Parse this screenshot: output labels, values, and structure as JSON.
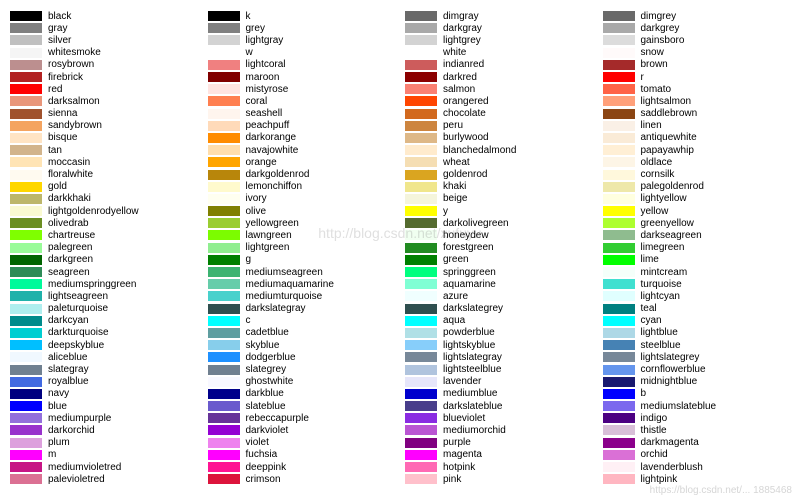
{
  "watermark": "http://blog.csdn.net/xufuyu",
  "corner": "https://blog.csdn.net/... 1885468",
  "chart_data": {
    "type": "table",
    "title": "",
    "columns": [
      [
        {
          "c": "#000000",
          "n": "black"
        },
        {
          "c": "#808080",
          "n": "gray"
        },
        {
          "c": "#C0C0C0",
          "n": "silver"
        },
        {
          "c": "#F5F5F5",
          "n": "whitesmoke"
        },
        {
          "c": "#BC8F8F",
          "n": "rosybrown"
        },
        {
          "c": "#B22222",
          "n": "firebrick"
        },
        {
          "c": "#FF0000",
          "n": "red"
        },
        {
          "c": "#E9967A",
          "n": "darksalmon"
        },
        {
          "c": "#A0522D",
          "n": "sienna"
        },
        {
          "c": "#F4A460",
          "n": "sandybrown"
        },
        {
          "c": "#FFE4C4",
          "n": "bisque"
        },
        {
          "c": "#D2B48C",
          "n": "tan"
        },
        {
          "c": "#FFE4B5",
          "n": "moccasin"
        },
        {
          "c": "#FFFAF0",
          "n": "floralwhite"
        },
        {
          "c": "#FFD700",
          "n": "gold"
        },
        {
          "c": "#BDB76B",
          "n": "darkkhaki"
        },
        {
          "c": "#FAFAD2",
          "n": "lightgoldenrodyellow"
        },
        {
          "c": "#6B8E23",
          "n": "olivedrab"
        },
        {
          "c": "#7FFF00",
          "n": "chartreuse"
        },
        {
          "c": "#98FB98",
          "n": "palegreen"
        },
        {
          "c": "#006400",
          "n": "darkgreen"
        },
        {
          "c": "#2E8B57",
          "n": "seagreen"
        },
        {
          "c": "#00FA9A",
          "n": "mediumspringgreen"
        },
        {
          "c": "#20B2AA",
          "n": "lightseagreen"
        },
        {
          "c": "#AFEEEE",
          "n": "paleturquoise"
        },
        {
          "c": "#008B8B",
          "n": "darkcyan"
        },
        {
          "c": "#00CED1",
          "n": "darkturquoise"
        },
        {
          "c": "#00BFFF",
          "n": "deepskyblue"
        },
        {
          "c": "#F0F8FF",
          "n": "aliceblue"
        },
        {
          "c": "#708090",
          "n": "slategray"
        },
        {
          "c": "#4169E1",
          "n": "royalblue"
        },
        {
          "c": "#000080",
          "n": "navy"
        },
        {
          "c": "#0000FF",
          "n": "blue"
        },
        {
          "c": "#9370DB",
          "n": "mediumpurple"
        },
        {
          "c": "#9932CC",
          "n": "darkorchid"
        },
        {
          "c": "#DDA0DD",
          "n": "plum"
        },
        {
          "c": "#FF00FF",
          "n": "m"
        },
        {
          "c": "#C71585",
          "n": "mediumvioletred"
        },
        {
          "c": "#DB7093",
          "n": "palevioletred"
        }
      ],
      [
        {
          "c": "#000000",
          "n": "k"
        },
        {
          "c": "#808080",
          "n": "grey"
        },
        {
          "c": "#D3D3D3",
          "n": "lightgray"
        },
        {
          "c": "#FFFFFF",
          "n": "w"
        },
        {
          "c": "#F08080",
          "n": "lightcoral"
        },
        {
          "c": "#800000",
          "n": "maroon"
        },
        {
          "c": "#FFE4E1",
          "n": "mistyrose"
        },
        {
          "c": "#FF7F50",
          "n": "coral"
        },
        {
          "c": "#FFF5EE",
          "n": "seashell"
        },
        {
          "c": "#FFDAB9",
          "n": "peachpuff"
        },
        {
          "c": "#FF8C00",
          "n": "darkorange"
        },
        {
          "c": "#FFDEAD",
          "n": "navajowhite"
        },
        {
          "c": "#FFA500",
          "n": "orange"
        },
        {
          "c": "#B8860B",
          "n": "darkgoldenrod"
        },
        {
          "c": "#FFFACD",
          "n": "lemonchiffon"
        },
        {
          "c": "#FFFFF0",
          "n": "ivory"
        },
        {
          "c": "#808000",
          "n": "olive"
        },
        {
          "c": "#9ACD32",
          "n": "yellowgreen"
        },
        {
          "c": "#7CFC00",
          "n": "lawngreen"
        },
        {
          "c": "#90EE90",
          "n": "lightgreen"
        },
        {
          "c": "#008000",
          "n": "g"
        },
        {
          "c": "#3CB371",
          "n": "mediumseagreen"
        },
        {
          "c": "#66CDAA",
          "n": "mediumaquamarine"
        },
        {
          "c": "#48D1CC",
          "n": "mediumturquoise"
        },
        {
          "c": "#2F4F4F",
          "n": "darkslategray"
        },
        {
          "c": "#00FFFF",
          "n": "c"
        },
        {
          "c": "#5F9EA0",
          "n": "cadetblue"
        },
        {
          "c": "#87CEEB",
          "n": "skyblue"
        },
        {
          "c": "#1E90FF",
          "n": "dodgerblue"
        },
        {
          "c": "#708090",
          "n": "slategrey"
        },
        {
          "c": "#F8F8FF",
          "n": "ghostwhite"
        },
        {
          "c": "#00008B",
          "n": "darkblue"
        },
        {
          "c": "#6A5ACD",
          "n": "slateblue"
        },
        {
          "c": "#663399",
          "n": "rebeccapurple"
        },
        {
          "c": "#9400D3",
          "n": "darkviolet"
        },
        {
          "c": "#EE82EE",
          "n": "violet"
        },
        {
          "c": "#FF00FF",
          "n": "fuchsia"
        },
        {
          "c": "#FF1493",
          "n": "deeppink"
        },
        {
          "c": "#DC143C",
          "n": "crimson"
        }
      ],
      [
        {
          "c": "#696969",
          "n": "dimgray"
        },
        {
          "c": "#A9A9A9",
          "n": "darkgray"
        },
        {
          "c": "#D3D3D3",
          "n": "lightgrey"
        },
        {
          "c": "#FFFFFF",
          "n": "white"
        },
        {
          "c": "#CD5C5C",
          "n": "indianred"
        },
        {
          "c": "#8B0000",
          "n": "darkred"
        },
        {
          "c": "#FA8072",
          "n": "salmon"
        },
        {
          "c": "#FF4500",
          "n": "orangered"
        },
        {
          "c": "#D2691E",
          "n": "chocolate"
        },
        {
          "c": "#CD853F",
          "n": "peru"
        },
        {
          "c": "#DEB887",
          "n": "burlywood"
        },
        {
          "c": "#FFEBCD",
          "n": "blanchedalmond"
        },
        {
          "c": "#F5DEB3",
          "n": "wheat"
        },
        {
          "c": "#DAA520",
          "n": "goldenrod"
        },
        {
          "c": "#F0E68C",
          "n": "khaki"
        },
        {
          "c": "#F5F5DC",
          "n": "beige"
        },
        {
          "c": "#FFFF00",
          "n": "y"
        },
        {
          "c": "#556B2F",
          "n": "darkolivegreen"
        },
        {
          "c": "#F0FFF0",
          "n": "honeydew"
        },
        {
          "c": "#228B22",
          "n": "forestgreen"
        },
        {
          "c": "#008000",
          "n": "green"
        },
        {
          "c": "#00FF7F",
          "n": "springgreen"
        },
        {
          "c": "#7FFFD4",
          "n": "aquamarine"
        },
        {
          "c": "#F0FFFF",
          "n": "azure"
        },
        {
          "c": "#2F4F4F",
          "n": "darkslategrey"
        },
        {
          "c": "#00FFFF",
          "n": "aqua"
        },
        {
          "c": "#B0E0E6",
          "n": "powderblue"
        },
        {
          "c": "#87CEFA",
          "n": "lightskyblue"
        },
        {
          "c": "#778899",
          "n": "lightslategray"
        },
        {
          "c": "#B0C4DE",
          "n": "lightsteelblue"
        },
        {
          "c": "#E6E6FA",
          "n": "lavender"
        },
        {
          "c": "#0000CD",
          "n": "mediumblue"
        },
        {
          "c": "#483D8B",
          "n": "darkslateblue"
        },
        {
          "c": "#8A2BE2",
          "n": "blueviolet"
        },
        {
          "c": "#BA55D3",
          "n": "mediumorchid"
        },
        {
          "c": "#800080",
          "n": "purple"
        },
        {
          "c": "#FF00FF",
          "n": "magenta"
        },
        {
          "c": "#FF69B4",
          "n": "hotpink"
        },
        {
          "c": "#FFC0CB",
          "n": "pink"
        }
      ],
      [
        {
          "c": "#696969",
          "n": "dimgrey"
        },
        {
          "c": "#A9A9A9",
          "n": "darkgrey"
        },
        {
          "c": "#DCDCDC",
          "n": "gainsboro"
        },
        {
          "c": "#FFFAFA",
          "n": "snow"
        },
        {
          "c": "#A52A2A",
          "n": "brown"
        },
        {
          "c": "#FF0000",
          "n": "r"
        },
        {
          "c": "#FF6347",
          "n": "tomato"
        },
        {
          "c": "#FFA07A",
          "n": "lightsalmon"
        },
        {
          "c": "#8B4513",
          "n": "saddlebrown"
        },
        {
          "c": "#FAF0E6",
          "n": "linen"
        },
        {
          "c": "#FAEBD7",
          "n": "antiquewhite"
        },
        {
          "c": "#FFEFD5",
          "n": "papayawhip"
        },
        {
          "c": "#FDF5E6",
          "n": "oldlace"
        },
        {
          "c": "#FFF8DC",
          "n": "cornsilk"
        },
        {
          "c": "#EEE8AA",
          "n": "palegoldenrod"
        },
        {
          "c": "#FFFFE0",
          "n": "lightyellow"
        },
        {
          "c": "#FFFF00",
          "n": "yellow"
        },
        {
          "c": "#ADFF2F",
          "n": "greenyellow"
        },
        {
          "c": "#8FBC8F",
          "n": "darkseagreen"
        },
        {
          "c": "#32CD32",
          "n": "limegreen"
        },
        {
          "c": "#00FF00",
          "n": "lime"
        },
        {
          "c": "#F5FFFA",
          "n": "mintcream"
        },
        {
          "c": "#40E0D0",
          "n": "turquoise"
        },
        {
          "c": "#E0FFFF",
          "n": "lightcyan"
        },
        {
          "c": "#008080",
          "n": "teal"
        },
        {
          "c": "#00FFFF",
          "n": "cyan"
        },
        {
          "c": "#ADD8E6",
          "n": "lightblue"
        },
        {
          "c": "#4682B4",
          "n": "steelblue"
        },
        {
          "c": "#778899",
          "n": "lightslategrey"
        },
        {
          "c": "#6495ED",
          "n": "cornflowerblue"
        },
        {
          "c": "#191970",
          "n": "midnightblue"
        },
        {
          "c": "#0000FF",
          "n": "b"
        },
        {
          "c": "#7B68EE",
          "n": "mediumslateblue"
        },
        {
          "c": "#4B0082",
          "n": "indigo"
        },
        {
          "c": "#D8BFD8",
          "n": "thistle"
        },
        {
          "c": "#8B008B",
          "n": "darkmagenta"
        },
        {
          "c": "#DA70D6",
          "n": "orchid"
        },
        {
          "c": "#FFF0F5",
          "n": "lavenderblush"
        },
        {
          "c": "#FFB6C1",
          "n": "lightpink"
        }
      ]
    ]
  }
}
